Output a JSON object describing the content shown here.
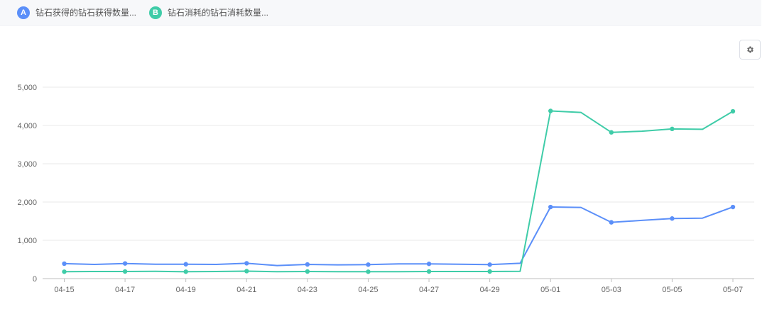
{
  "legend": {
    "items": [
      {
        "badge": "A",
        "label": "钻石获得的钻石获得数量...",
        "color": "#5b8ff9"
      },
      {
        "badge": "B",
        "label": "钻石消耗的钻石消耗数量...",
        "color": "#3fcca8"
      }
    ]
  },
  "toolbar": {
    "settings_icon": "gear-icon"
  },
  "chart_data": {
    "type": "line",
    "x": [
      "04-15",
      "04-16",
      "04-17",
      "04-18",
      "04-19",
      "04-20",
      "04-21",
      "04-22",
      "04-23",
      "04-24",
      "04-25",
      "04-26",
      "04-27",
      "04-28",
      "04-29",
      "04-30",
      "05-01",
      "05-02",
      "05-03",
      "05-04",
      "05-05",
      "05-06",
      "05-07"
    ],
    "x_tick_labels": [
      "04-15",
      "04-17",
      "04-19",
      "04-21",
      "04-23",
      "04-25",
      "04-27",
      "04-29",
      "05-01",
      "05-03",
      "05-05",
      "05-07"
    ],
    "series": [
      {
        "name": "钻石获得的钻石获得数量...",
        "color": "#5b8ff9",
        "values": [
          390,
          370,
          395,
          375,
          375,
          370,
          400,
          340,
          370,
          360,
          365,
          385,
          385,
          375,
          365,
          400,
          1870,
          1860,
          1470,
          1520,
          1570,
          1580,
          1870
        ],
        "markers": [
          true,
          false,
          true,
          false,
          true,
          false,
          true,
          false,
          true,
          false,
          true,
          false,
          true,
          false,
          true,
          false,
          true,
          false,
          true,
          false,
          true,
          false,
          true
        ]
      },
      {
        "name": "钻石消耗的钻石消耗数量...",
        "color": "#3fcca8",
        "values": [
          180,
          185,
          185,
          190,
          180,
          185,
          195,
          180,
          185,
          180,
          180,
          180,
          185,
          185,
          185,
          190,
          4380,
          4340,
          3820,
          3850,
          3910,
          3900,
          4370
        ],
        "markers": [
          true,
          false,
          true,
          false,
          true,
          false,
          true,
          false,
          true,
          false,
          true,
          false,
          true,
          false,
          true,
          false,
          true,
          false,
          true,
          false,
          true,
          false,
          true
        ]
      }
    ],
    "y_ticks": [
      0,
      1000,
      2000,
      3000,
      4000,
      5000
    ],
    "y_tick_labels": [
      "0",
      "1,000",
      "2,000",
      "3,000",
      "4,000",
      "5,000"
    ],
    "ylim": [
      0,
      5000
    ],
    "grid": true,
    "legend": "top"
  }
}
